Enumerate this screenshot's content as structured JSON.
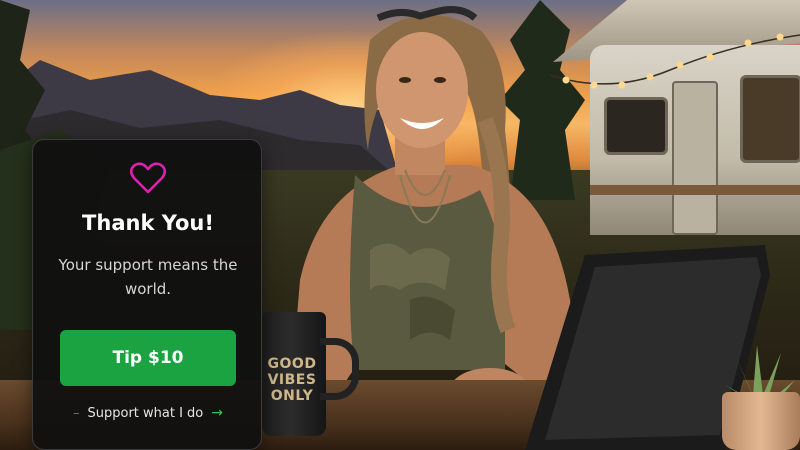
{
  "tip_card": {
    "title": "Thank You!",
    "subtitle": "Your support means the world.",
    "tip_button_label": "Tip $10",
    "support_link_label": "Support what I do",
    "heart_icon": "heart-outline-icon",
    "dash_icon": "dash-icon",
    "arrow_icon": "arrow-right-icon",
    "accent_color": "#e020b0",
    "button_color": "#1aa340"
  },
  "background_photo": {
    "mug_text": "GOOD\nVIBES\nONLY"
  }
}
